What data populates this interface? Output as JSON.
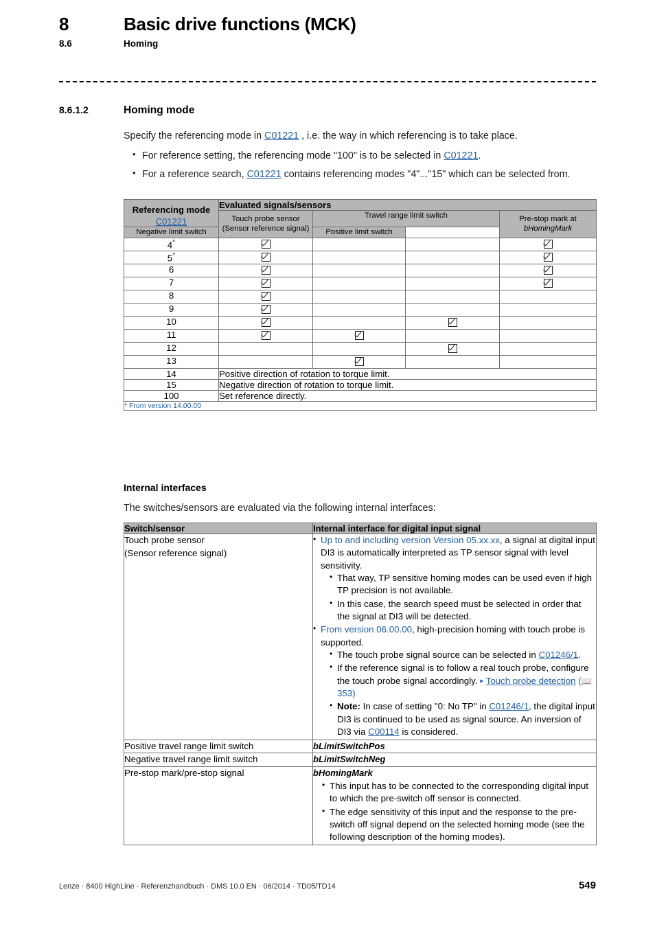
{
  "header": {
    "chapter_number": "8",
    "chapter_title": "Basic drive functions (MCK)",
    "section_number": "8.6",
    "section_title": "Homing"
  },
  "section": {
    "number": "8.6.1.2",
    "title": "Homing mode",
    "intro_a": "Specify the referencing mode in ",
    "intro_link": "C01221",
    "intro_b": " , i.e. the way in which referencing is to take place.",
    "bullets": [
      {
        "a": "For reference setting, the referencing mode \"100\" is to be selected in ",
        "link": "C01221",
        "b": "."
      },
      {
        "a": "For a reference search, ",
        "link": "C01221",
        "b": " contains referencing modes \"4\"...\"15\" which can be selected from."
      }
    ]
  },
  "table1": {
    "header": {
      "col1_title": "Referencing mode",
      "col1_link": "C01221",
      "group_title": "Evaluated signals/sensors",
      "touch_probe": "Touch probe sensor",
      "touch_probe_sub": "(Sensor reference signal)",
      "travel_range": "Travel range limit switch",
      "negative_limit": "Negative limit switch",
      "positive_limit": "Positive limit switch",
      "prestop_a": "Pre-stop mark at",
      "prestop_b": "bHomingMark"
    },
    "rows": [
      {
        "mode": "4",
        "footnote": "*",
        "tp": true,
        "neg": false,
        "pos": false,
        "pre": true
      },
      {
        "mode": "5",
        "footnote": "*",
        "tp": true,
        "neg": false,
        "pos": false,
        "pre": true
      },
      {
        "mode": "6",
        "footnote": "",
        "tp": true,
        "neg": false,
        "pos": false,
        "pre": true
      },
      {
        "mode": "7",
        "footnote": "",
        "tp": true,
        "neg": false,
        "pos": false,
        "pre": true
      },
      {
        "mode": "8",
        "footnote": "",
        "tp": true,
        "neg": false,
        "pos": false,
        "pre": false
      },
      {
        "mode": "9",
        "footnote": "",
        "tp": true,
        "neg": false,
        "pos": false,
        "pre": false
      },
      {
        "mode": "10",
        "footnote": "",
        "tp": true,
        "neg": false,
        "pos": true,
        "pre": false
      },
      {
        "mode": "11",
        "footnote": "",
        "tp": true,
        "neg": true,
        "pos": false,
        "pre": false
      },
      {
        "mode": "12",
        "footnote": "",
        "tp": false,
        "neg": false,
        "pos": true,
        "pre": false
      },
      {
        "mode": "13",
        "footnote": "",
        "tp": false,
        "neg": true,
        "pos": false,
        "pre": false
      }
    ],
    "text_rows": [
      {
        "mode": "14",
        "text": "Positive direction of rotation to torque limit."
      },
      {
        "mode": "15",
        "text": "Negative direction of rotation to torque limit."
      },
      {
        "mode": "100",
        "text": "Set reference directly."
      }
    ],
    "footnote": "* From version 14.00.00"
  },
  "internal": {
    "heading": "Internal interfaces",
    "intro": "The switches/sensors are evaluated via the following internal interfaces:",
    "table": {
      "header": {
        "col1": "Switch/sensor",
        "col2": "Internal interface for digital input signal"
      },
      "row1": {
        "label_a": "Touch probe sensor",
        "label_b": "(Sensor reference signal)",
        "b1_link": "Up to and including version Version 05.xx.xx",
        "b1_text": ", a signal at digital input DI3 is automatically interpreted as TP sensor signal with level sensitivity.",
        "b1_sub1": "That way, TP sensitive homing modes can be used even if high TP precision is not available.",
        "b1_sub2": "In this case, the search speed must be selected in order that the signal at DI3 will be detected.",
        "b2_link": "From version 06.00.00",
        "b2_text": ", high-precision homing with touch probe is supported.",
        "b2_sub1_a": "The touch probe signal source can be selected in ",
        "b2_sub1_link": "C01246/1",
        "b2_sub1_b": ".",
        "b2_sub2_a": "If the reference signal is to follow a real touch probe, configure the touch probe signal accordingly. ",
        "b2_sub2_arrow": "▸",
        "b2_sub2_link": "Touch probe detection",
        "b2_sub2_book": "📖",
        "b2_sub2_page": "353",
        "b2_sub3_note": "Note:",
        "b2_sub3_a": " In case of setting \"0: No TP\" in ",
        "b2_sub3_link1": "C01246/1",
        "b2_sub3_b": ", the digital input DI3 is continued to be used as signal source. An inversion of DI3 via ",
        "b2_sub3_link2": "C00114",
        "b2_sub3_c": " is considered."
      },
      "row2": {
        "label": "Positive travel range limit switch",
        "value": "bLimitSwitchPos"
      },
      "row3": {
        "label": "Negative travel range limit switch",
        "value": "bLimitSwitchNeg"
      },
      "row4": {
        "label": "Pre-stop mark/pre-stop signal",
        "value": "bHomingMark",
        "sub1": "This input has to be connected to the corresponding digital input to which the pre-switch off sensor is connected.",
        "sub2": "The edge sensitivity of this input and the response to the pre-switch off signal depend on the selected homing mode (see the following description of the homing modes)."
      }
    }
  },
  "footer": {
    "text": "Lenze · 8400 HighLine · Referenzhandbuch · DMS 10.0 EN · 06/2014 · TD05/TD14",
    "page": "549"
  },
  "colors": {
    "link": "#1f5fa9",
    "table_header_bg": "#b6b6b6",
    "border": "#6f6f6f"
  }
}
